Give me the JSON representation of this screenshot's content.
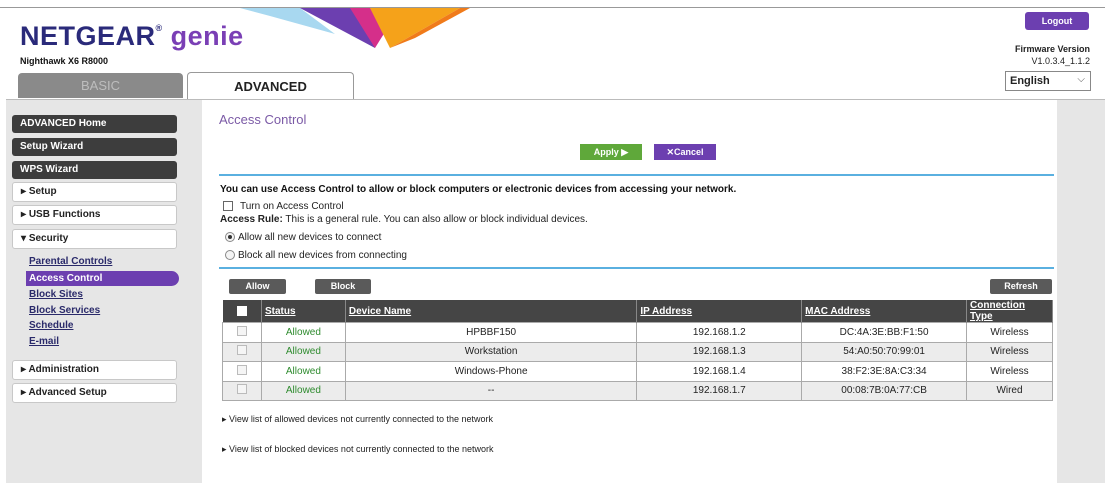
{
  "header": {
    "brand": "NETGEAR",
    "brand_sub": "genie",
    "model": "Nighthawk X6 R8000",
    "logout_label": "Logout",
    "firmware_label": "Firmware Version",
    "firmware_version": "V1.0.3.4_1.1.2",
    "language": "English",
    "tab_basic": "BASIC",
    "tab_advanced": "ADVANCED"
  },
  "sidebar": {
    "dark_items": [
      "ADVANCED Home",
      "Setup Wizard",
      "WPS Wizard"
    ],
    "menu_items": [
      "Setup",
      "USB Functions",
      "Security",
      "Administration",
      "Advanced Setup"
    ],
    "security_subitems": [
      "Parental Controls",
      "Access Control",
      "Block Sites",
      "Block Services",
      "Schedule",
      "E-mail"
    ]
  },
  "main": {
    "title": "Access Control",
    "apply_label": "Apply ▶",
    "cancel_label": "Cancel",
    "intro": "You can use Access Control to allow or block computers or electronic devices from accessing your network.",
    "turn_on_label": "Turn on Access Control",
    "access_rule_label": "Access Rule:",
    "access_rule_text": "This is a general rule. You can also allow or block individual devices.",
    "radio_allow": "Allow all new devices to connect",
    "radio_block": "Block all new devices from connecting",
    "allow_button": "Allow",
    "block_button": "Block",
    "refresh_button": "Refresh",
    "table": {
      "headers": [
        "Status",
        "Device Name",
        "IP Address",
        "MAC Address",
        "Connection Type"
      ],
      "rows": [
        {
          "status": "Allowed",
          "name": "HPBBF150",
          "ip": "192.168.1.2",
          "mac": "DC:4A:3E:BB:F1:50",
          "type": "Wireless"
        },
        {
          "status": "Allowed",
          "name": "Workstation",
          "ip": "192.168.1.3",
          "mac": "54:A0:50:70:99:01",
          "type": "Wireless"
        },
        {
          "status": "Allowed",
          "name": "Windows-Phone",
          "ip": "192.168.1.4",
          "mac": "38:F2:3E:8A:C3:34",
          "type": "Wireless"
        },
        {
          "status": "Allowed",
          "name": "--",
          "ip": "192.168.1.7",
          "mac": "00:08:7B:0A:77:CB",
          "type": "Wired"
        }
      ]
    },
    "link_allowed": "View list of allowed devices not currently connected to the network",
    "link_blocked": "View list of blocked devices not currently connected to the network"
  },
  "colors": {
    "brand_purple": "#6c3fb0",
    "apply_green": "#5fa83a",
    "divider_blue": "#5ab0e0",
    "status_green": "#2e8b2e"
  }
}
